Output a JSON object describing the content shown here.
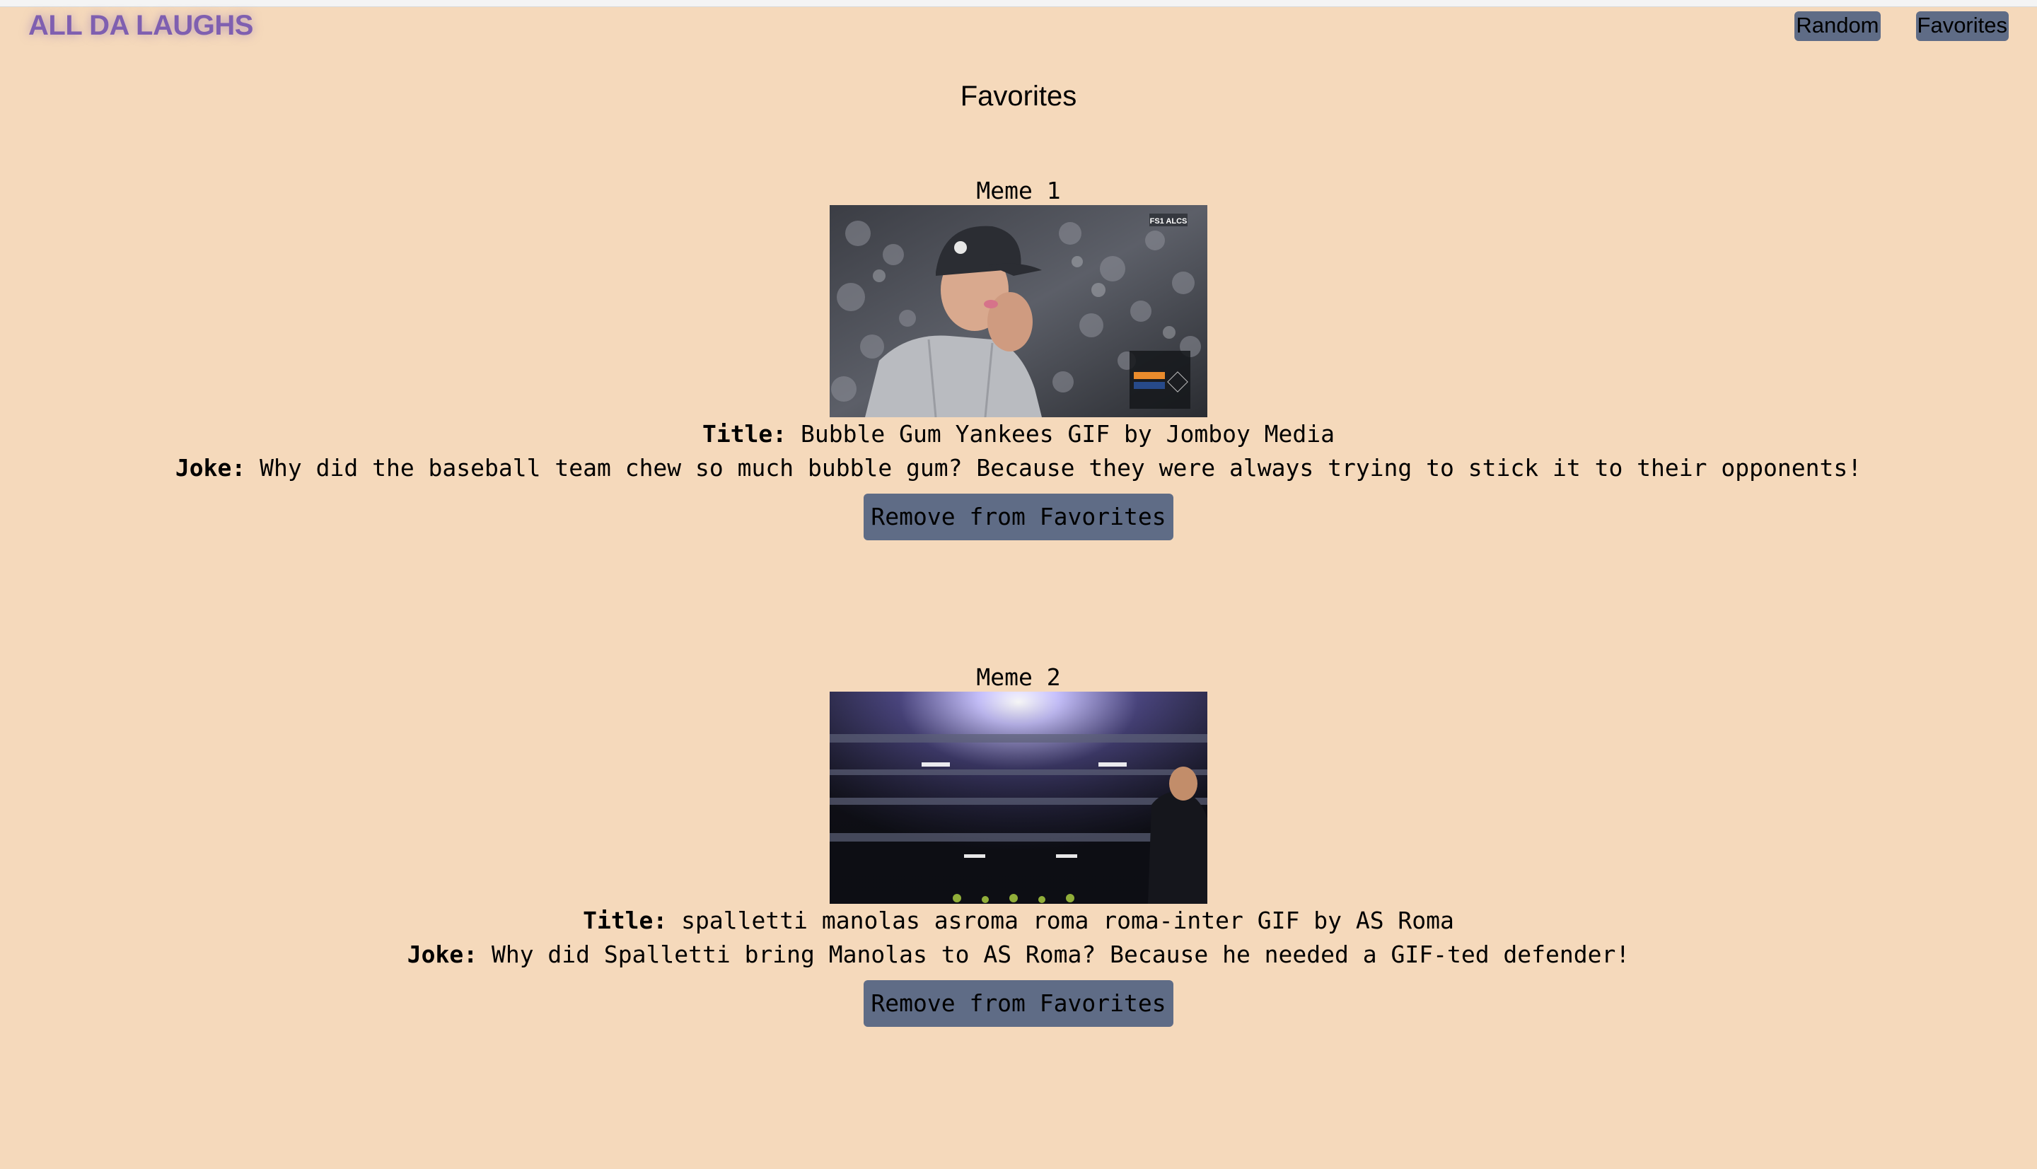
{
  "brand": "ALL DA LAUGHS",
  "nav": {
    "random_label": "Random",
    "favorites_label": "Favorites"
  },
  "page": {
    "title": "Favorites"
  },
  "labels": {
    "title_prefix": "Title:",
    "joke_prefix": "Joke:"
  },
  "memes": [
    {
      "label": "Meme 1",
      "title": "Bubble Gum Yankees GIF by Jomboy Media",
      "joke": "Why did the baseball team chew so much bubble gum? Because they were always trying to stick it to their opponents!",
      "remove_label": "Remove from Favorites",
      "gif_overlay": "FS1 ALCS"
    },
    {
      "label": "Meme 2",
      "title": "spalletti manolas asroma roma roma-inter GIF by AS Roma",
      "joke": "Why did Spalletti bring Manolas to AS Roma? Because he needed a GIF-ted defender!",
      "remove_label": "Remove from Favorites"
    }
  ]
}
